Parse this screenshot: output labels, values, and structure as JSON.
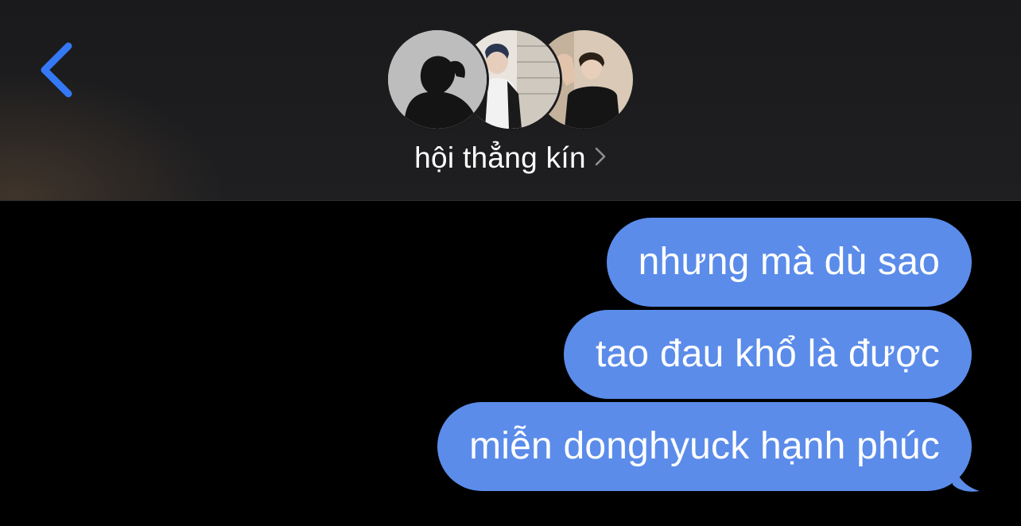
{
  "header": {
    "back_icon": "chevron-left-icon",
    "group_name": "hội thẳng kín",
    "disclosure_icon": "chevron-right-icon",
    "avatars": [
      {
        "name": "avatar-1"
      },
      {
        "name": "avatar-2"
      },
      {
        "name": "avatar-3"
      }
    ]
  },
  "messages": [
    {
      "text": "nhưng mà dù sao"
    },
    {
      "text": "tao đau khổ là được"
    },
    {
      "text": "miễn donghyuck hạnh phúc"
    }
  ],
  "colors": {
    "accent": "#3478f6",
    "bubble": "#5b8cea",
    "header_bg": "#1c1c1e",
    "background": "#000000",
    "text": "#ffffff"
  }
}
